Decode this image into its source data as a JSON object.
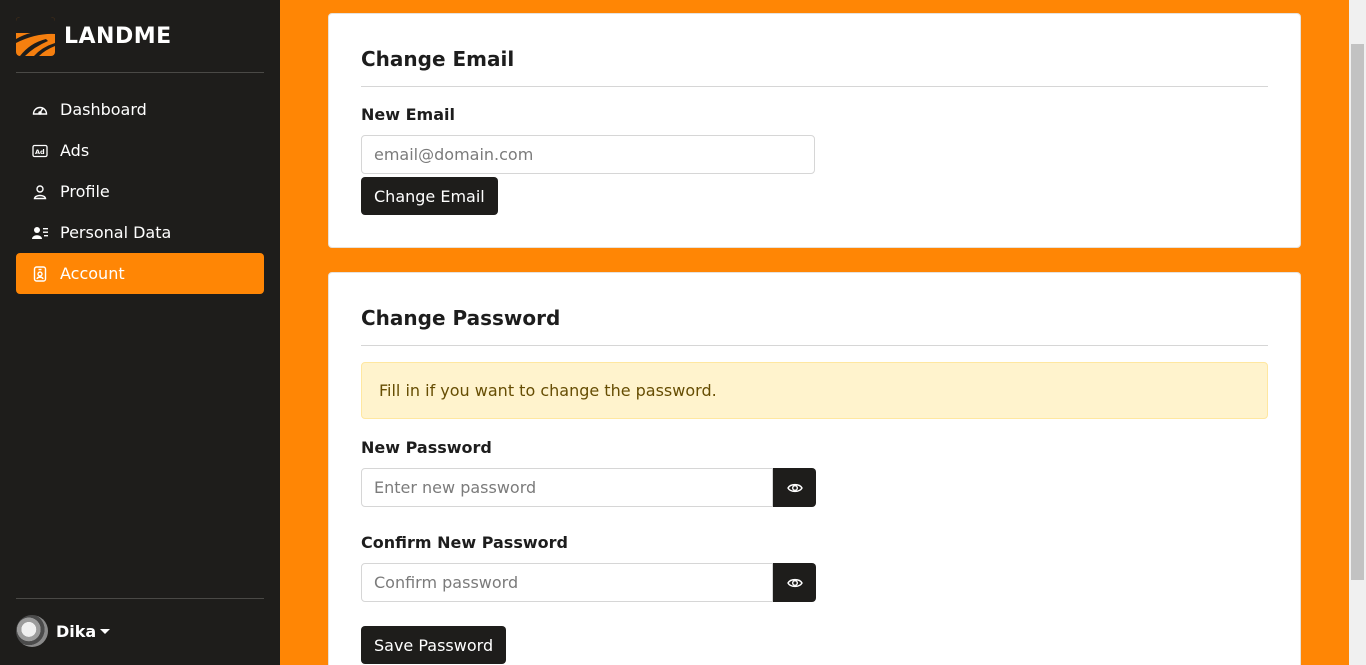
{
  "brand": {
    "name": "LANDME"
  },
  "sidebar": {
    "items": [
      {
        "label": "Dashboard",
        "icon": "dashboard-icon",
        "active": false
      },
      {
        "label": "Ads",
        "icon": "ad-icon",
        "active": false
      },
      {
        "label": "Profile",
        "icon": "person-icon",
        "active": false
      },
      {
        "label": "Personal Data",
        "icon": "person-lines-icon",
        "active": false
      },
      {
        "label": "Account",
        "icon": "person-badge-icon",
        "active": true
      }
    ],
    "user": {
      "name": "Dika"
    }
  },
  "email_card": {
    "title": "Change Email",
    "new_email_label": "New Email",
    "email_placeholder": "email@domain.com",
    "button_label": "Change Email"
  },
  "password_card": {
    "title": "Change Password",
    "alert_text": "Fill in if you want to change the password.",
    "new_password_label": "New Password",
    "new_password_placeholder": "Enter new password",
    "confirm_label": "Confirm New Password",
    "confirm_placeholder": "Confirm password",
    "button_label": "Save Password"
  },
  "colors": {
    "accent": "#ff8605",
    "sidebar_bg": "#1e1d1b",
    "alert_bg": "#fff3cd"
  }
}
